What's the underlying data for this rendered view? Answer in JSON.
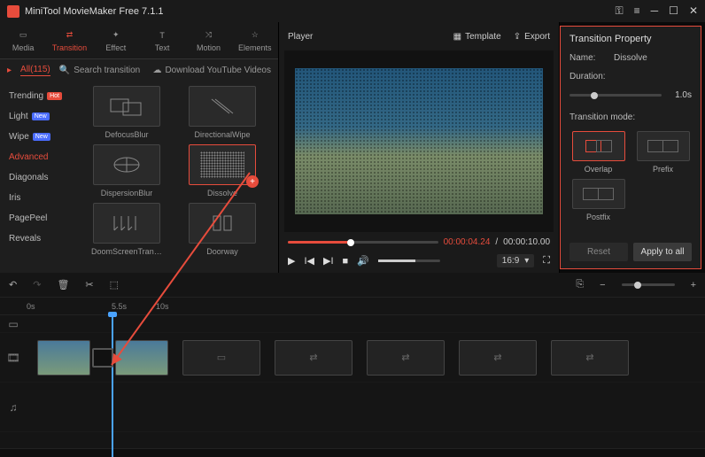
{
  "titlebar": {
    "title": "MiniTool MovieMaker Free 7.1.1"
  },
  "tabs": [
    {
      "label": "Media",
      "icon": "folder"
    },
    {
      "label": "Transition",
      "icon": "transition",
      "active": true
    },
    {
      "label": "Effect",
      "icon": "sparkle"
    },
    {
      "label": "Text",
      "icon": "text"
    },
    {
      "label": "Motion",
      "icon": "motion"
    },
    {
      "label": "Elements",
      "icon": "elements"
    }
  ],
  "filter": {
    "all_label": "All(115)",
    "search_placeholder": "Search transition",
    "download_label": "Download YouTube Videos"
  },
  "categories": [
    {
      "label": "Trending",
      "badge": "Hot",
      "badge_cls": "hot"
    },
    {
      "label": "Light",
      "badge": "New",
      "badge_cls": "new"
    },
    {
      "label": "Wipe",
      "badge": "New",
      "badge_cls": "new"
    },
    {
      "label": "Advanced",
      "active": true
    },
    {
      "label": "Diagonals"
    },
    {
      "label": "Iris"
    },
    {
      "label": "PagePeel"
    },
    {
      "label": "Reveals"
    }
  ],
  "thumbs": [
    {
      "label": "DefocusBlur"
    },
    {
      "label": "DirectionalWipe"
    },
    {
      "label": "DispersionBlur"
    },
    {
      "label": "Dissolve",
      "selected": true,
      "add": true
    },
    {
      "label": "DoomScreenTransit…"
    },
    {
      "label": "Doorway"
    }
  ],
  "player": {
    "header_label": "Player",
    "template_label": "Template",
    "export_label": "Export",
    "time_current": "00:00:04.24",
    "time_total": "00:00:10.00",
    "aspect": "16:9"
  },
  "property": {
    "title": "Transition Property",
    "name_label": "Name:",
    "name_value": "Dissolve",
    "duration_label": "Duration:",
    "duration_value": "1.0s",
    "mode_label": "Transition mode:",
    "modes": [
      "Overlap",
      "Prefix",
      "Postfix"
    ],
    "reset_label": "Reset",
    "apply_label": "Apply to all"
  },
  "ruler": {
    "m0": "0s",
    "m1": "5.5s",
    "m2": "10s"
  }
}
